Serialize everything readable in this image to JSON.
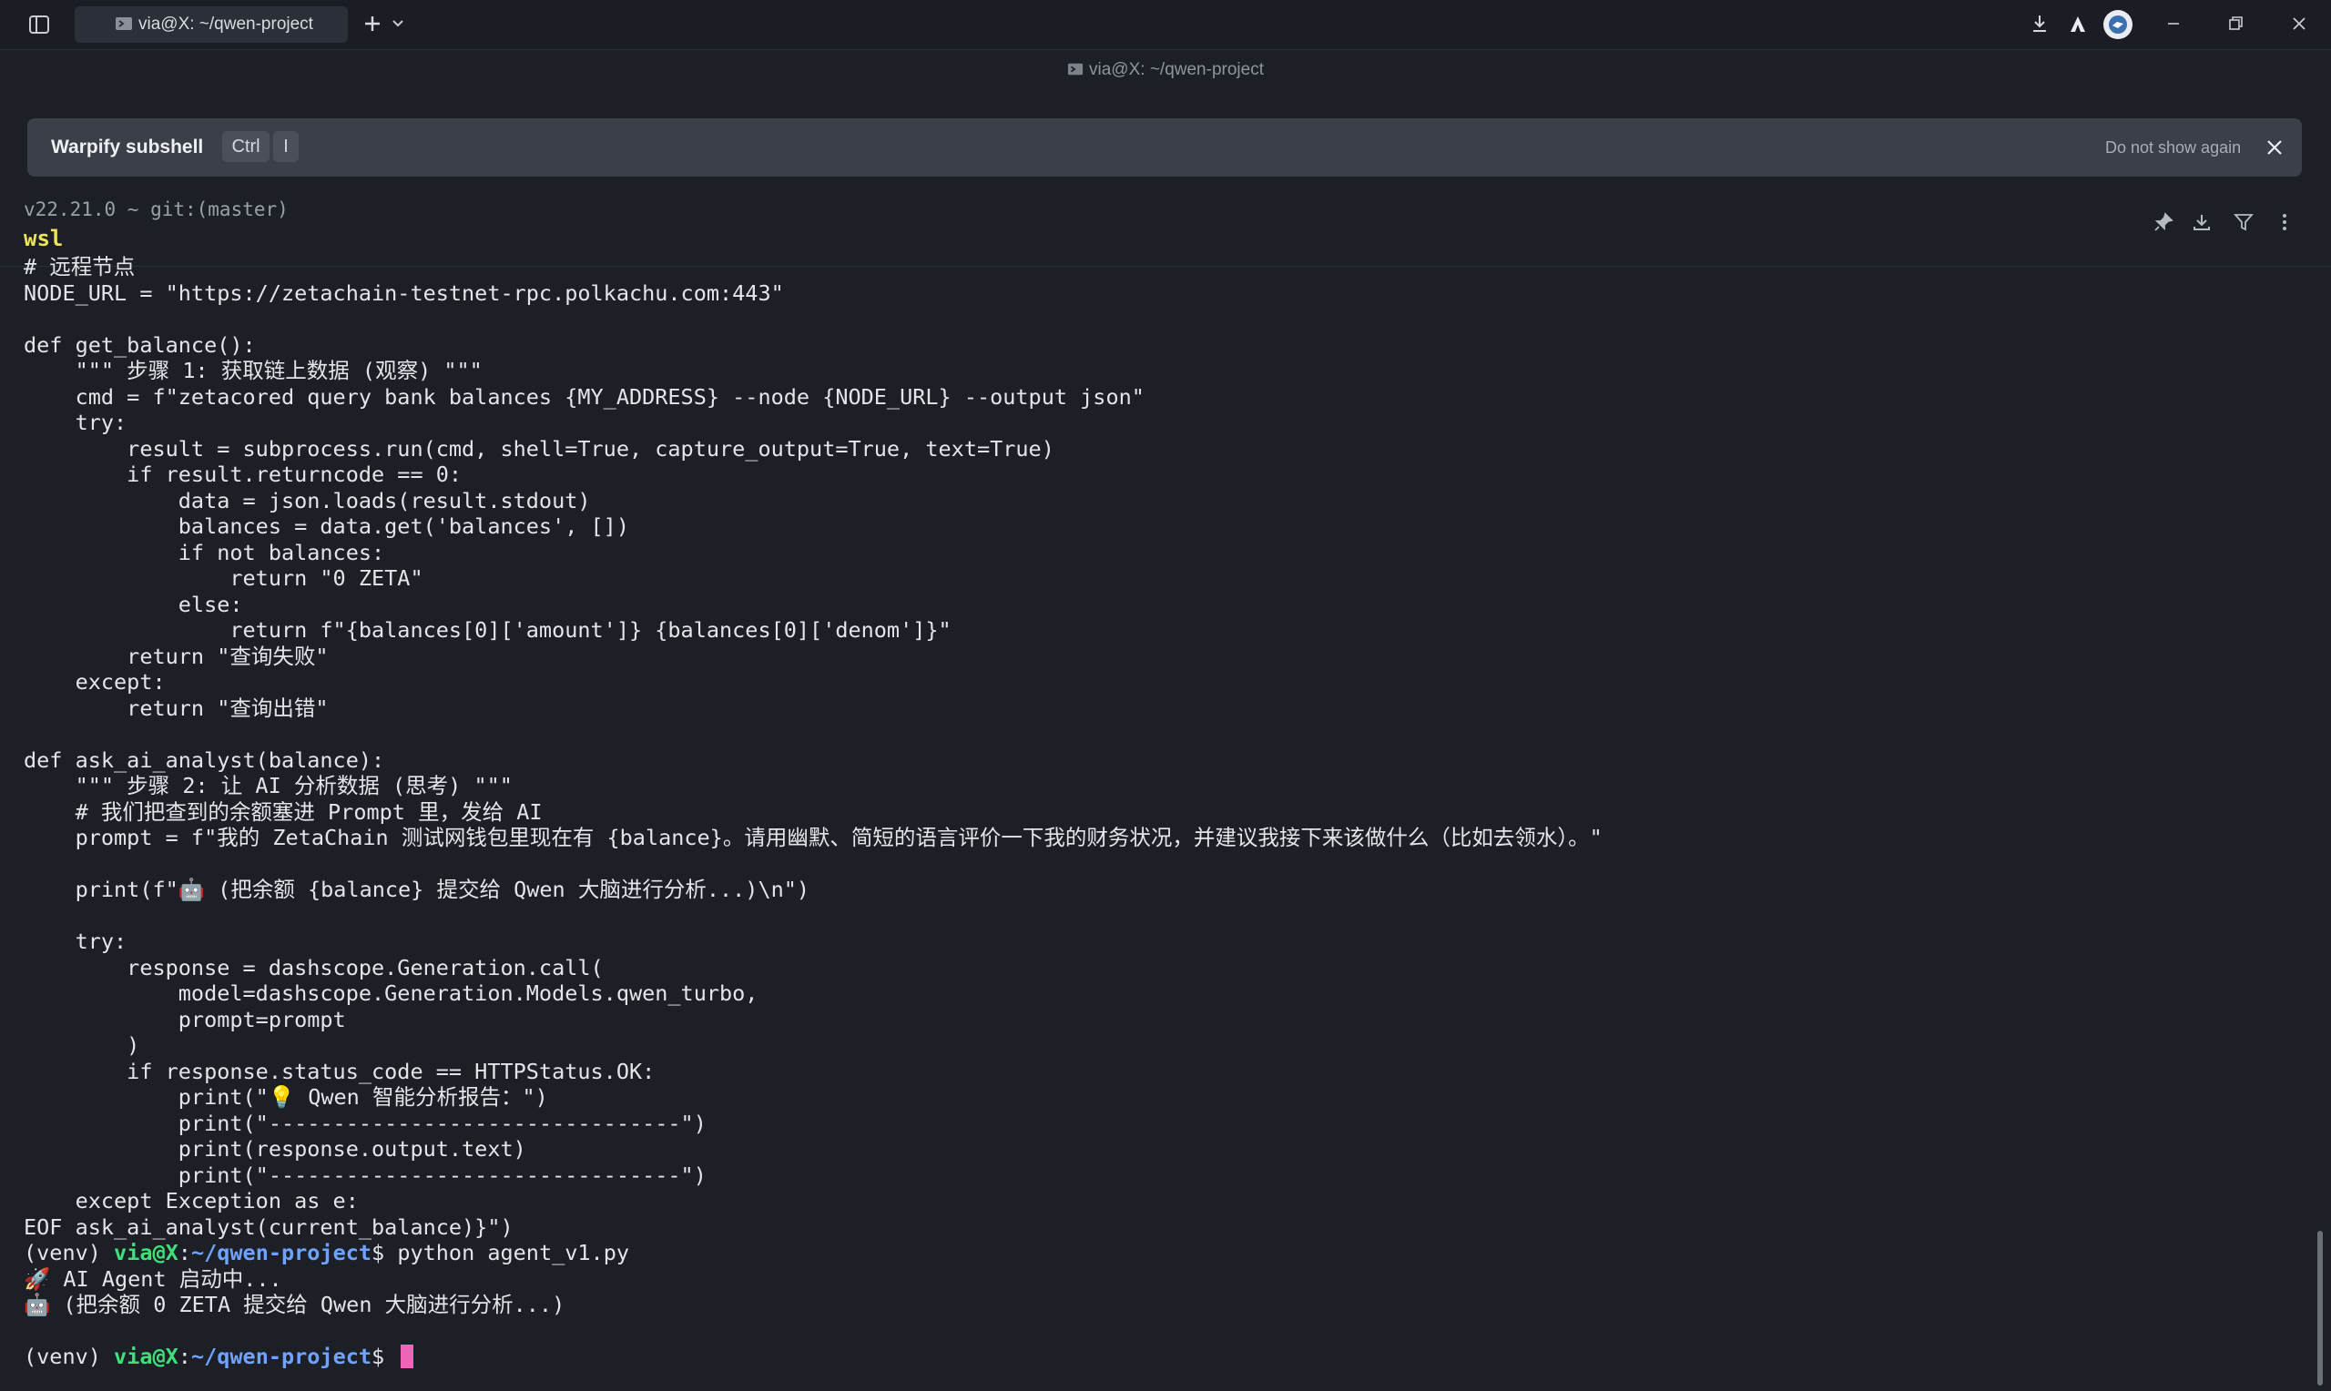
{
  "titlebar": {
    "tab_title": "via@X: ~/qwen-project",
    "icons": [
      "sidebar-toggle-icon",
      "terminal-icon",
      "plus-icon",
      "chevron-down-icon",
      "download-icon",
      "warp-icon",
      "avatar-icon",
      "minimize-icon",
      "restore-icon",
      "close-icon"
    ]
  },
  "window": {
    "subtitle": "via@X: ~/qwen-project"
  },
  "banner": {
    "title": "Warpify subshell",
    "key1": "Ctrl",
    "key2": "I",
    "dismiss": "Do not show again"
  },
  "block": {
    "prompt_info": "v22.21.0 ~ git:(master)",
    "command": "wsl"
  },
  "terminal": {
    "lines": [
      "# 远程节点",
      "NODE_URL = \"https://zetachain-testnet-rpc.polkachu.com:443\"",
      "",
      "def get_balance():",
      "    \"\"\" 步骤 1: 获取链上数据 (观察) \"\"\"",
      "    cmd = f\"zetacored query bank balances {MY_ADDRESS} --node {NODE_URL} --output json\"",
      "    try:",
      "        result = subprocess.run(cmd, shell=True, capture_output=True, text=True)",
      "        if result.returncode == 0:",
      "            data = json.loads(result.stdout)",
      "            balances = data.get('balances', [])",
      "            if not balances:",
      "                return \"0 ZETA\"",
      "            else:",
      "                return f\"{balances[0]['amount']} {balances[0]['denom']}\"",
      "        return \"查询失败\"",
      "    except:",
      "        return \"查询出错\"",
      "",
      "def ask_ai_analyst(balance):",
      "    \"\"\" 步骤 2: 让 AI 分析数据 (思考) \"\"\"",
      "    # 我们把查到的余额塞进 Prompt 里，发给 AI",
      "    prompt = f\"我的 ZetaChain 测试网钱包里现在有 {balance}。请用幽默、简短的语言评价一下我的财务状况，并建议我接下来该做什么（比如去领水）。\"",
      "",
      "    print(f\"🤖 (把余额 {balance} 提交给 Qwen 大脑进行分析...)\\n\")",
      "",
      "    try:",
      "        response = dashscope.Generation.call(",
      "            model=dashscope.Generation.Models.qwen_turbo,",
      "            prompt=prompt",
      "        )",
      "        if response.status_code == HTTPStatus.OK:",
      "            print(\"💡 Qwen 智能分析报告：\")",
      "            print(\"--------------------------------\")",
      "            print(response.output.text)",
      "            print(\"--------------------------------\")",
      "    except Exception as e:",
      "EOF ask_ai_analyst(current_balance)}\")"
    ],
    "prompt_prefix": "(venv) ",
    "prompt_user": "via@X",
    "prompt_colon": ":",
    "prompt_path": "~/qwen-project",
    "prompt_symbol": "$ ",
    "run_command": "python agent_v1.py",
    "output": [
      "🚀 AI Agent 启动中...",
      "🤖 (把余额 0 ZETA 提交给 Qwen 大脑进行分析...)",
      ""
    ],
    "final_prompt_prefix": "(venv) ",
    "final_prompt_user": "via@X",
    "final_prompt_colon": ":",
    "final_prompt_path": "~/qwen-project",
    "final_prompt_symbol": "$ "
  }
}
